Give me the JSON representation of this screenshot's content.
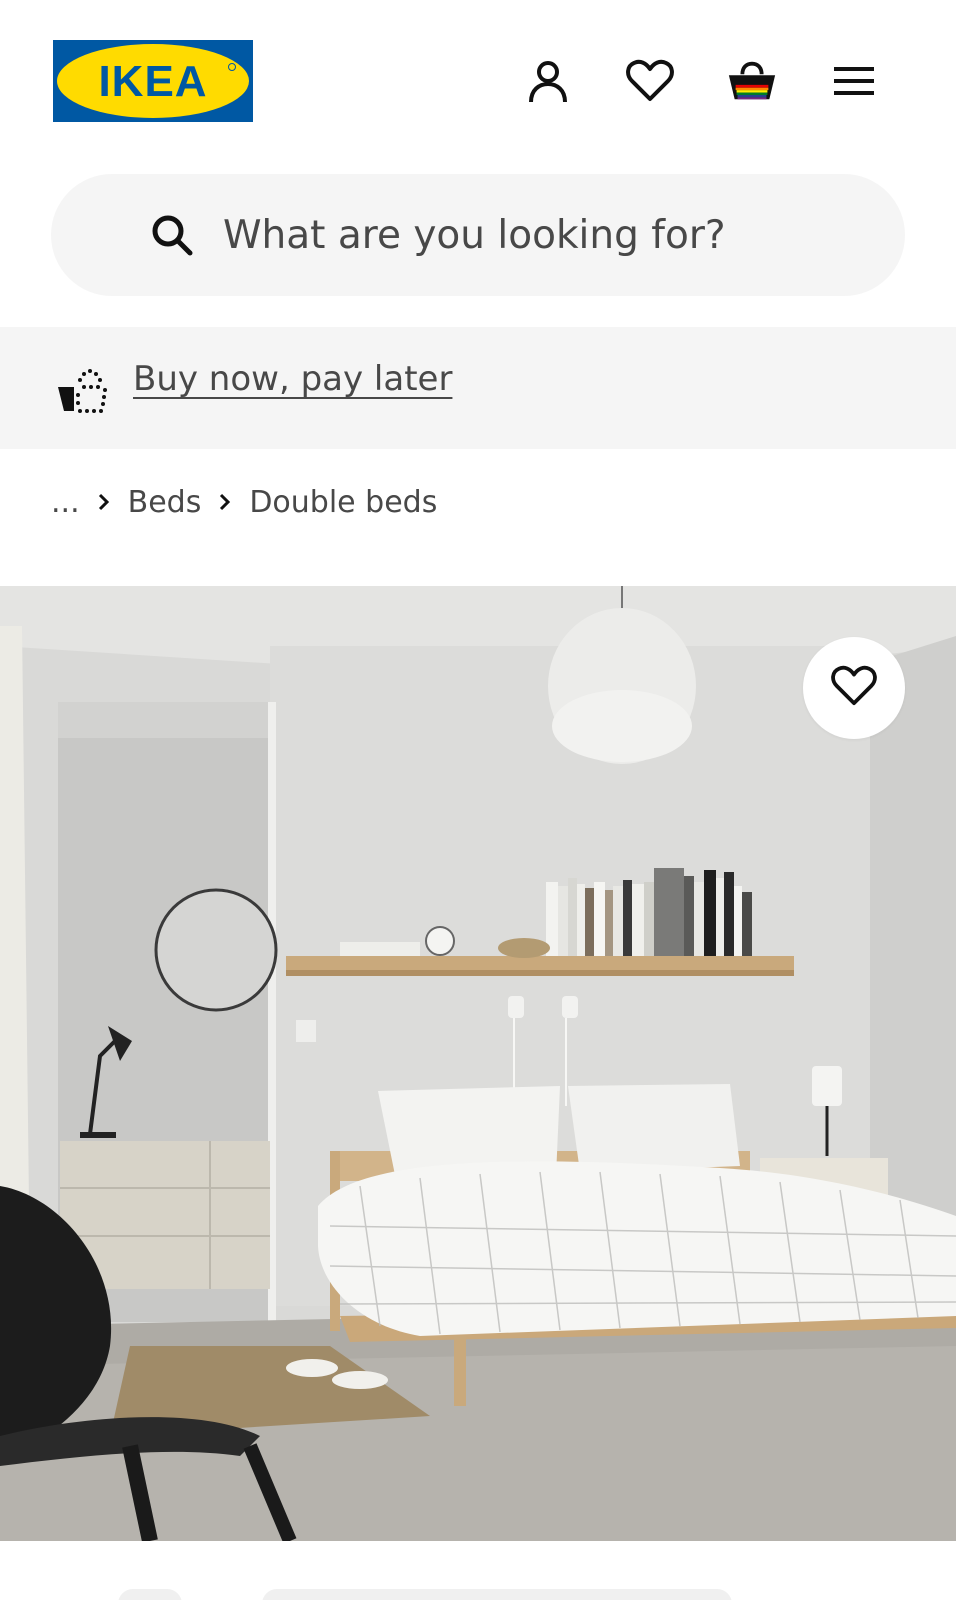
{
  "header": {
    "logo_text": "IKEA",
    "logo_colors": {
      "blue": "#0058a3",
      "yellow": "#ffdb00"
    },
    "icons": [
      "profile-icon",
      "heart-icon",
      "shopping-basket-icon",
      "hamburger-menu-icon"
    ]
  },
  "search": {
    "placeholder": "What are you looking for?"
  },
  "promo": {
    "icon": "buy-now-pay-later-icon",
    "link_text": "Buy now, pay later"
  },
  "breadcrumb": {
    "ellipsis": "...",
    "items": [
      "Beds",
      "Double beds"
    ]
  },
  "product_image": {
    "favourite_icon": "heart-icon"
  }
}
